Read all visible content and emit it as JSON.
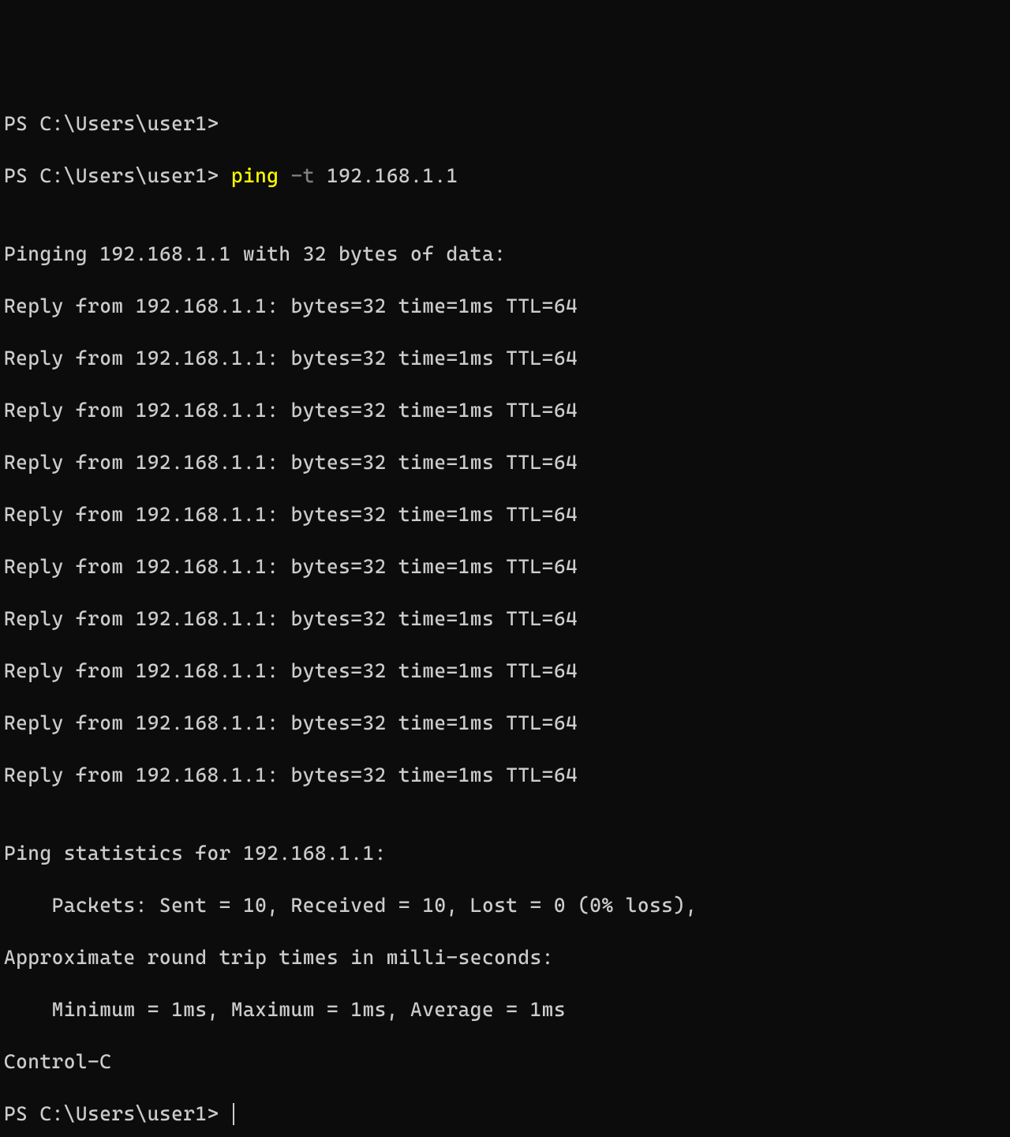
{
  "prompt1": "PS C:\\Users\\user1>",
  "prompt2": "PS C:\\Users\\user1> ",
  "command": "ping",
  "arg": "-t",
  "address": "192.168.1.1",
  "pinging_line": "Pinging 192.168.1.1 with 32 bytes of data:",
  "replies": [
    "Reply from 192.168.1.1: bytes=32 time=1ms TTL=64",
    "Reply from 192.168.1.1: bytes=32 time=1ms TTL=64",
    "Reply from 192.168.1.1: bytes=32 time=1ms TTL=64",
    "Reply from 192.168.1.1: bytes=32 time=1ms TTL=64",
    "Reply from 192.168.1.1: bytes=32 time=1ms TTL=64",
    "Reply from 192.168.1.1: bytes=32 time=1ms TTL=64",
    "Reply from 192.168.1.1: bytes=32 time=1ms TTL=64",
    "Reply from 192.168.1.1: bytes=32 time=1ms TTL=64",
    "Reply from 192.168.1.1: bytes=32 time=1ms TTL=64",
    "Reply from 192.168.1.1: bytes=32 time=1ms TTL=64"
  ],
  "stats_header": "Ping statistics for 192.168.1.1:",
  "stats_packets": "    Packets: Sent = 10, Received = 10, Lost = 0 (0% loss),",
  "stats_rtt_header": "Approximate round trip times in milli-seconds:",
  "stats_rtt": "    Minimum = 1ms, Maximum = 1ms, Average = 1ms",
  "ctrlc": "Control-C",
  "prompt3": "PS C:\\Users\\user1> ",
  "blank": ""
}
